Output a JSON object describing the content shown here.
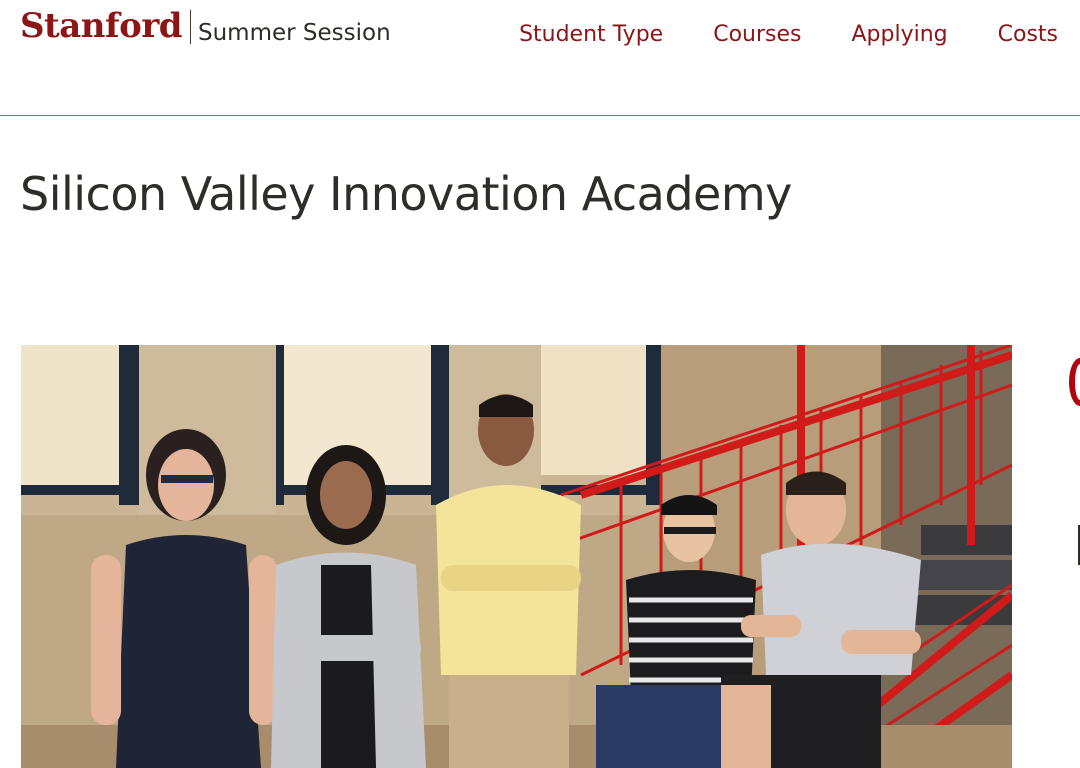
{
  "header": {
    "brand": "Stanford",
    "site_name": "Summer Session",
    "nav": [
      {
        "label": "Student Type"
      },
      {
        "label": "Courses"
      },
      {
        "label": "Applying"
      },
      {
        "label": "Costs"
      }
    ]
  },
  "main": {
    "title": "Silicon Valley Innovation Academy"
  },
  "colors": {
    "brand_red": "#8c1515",
    "rule": "#b1656f",
    "text": "#2e2d29",
    "railing_red": "#d11a1a"
  },
  "icons": {
    "hero_photo": "group-photo-five-students-on-red-staircase"
  }
}
